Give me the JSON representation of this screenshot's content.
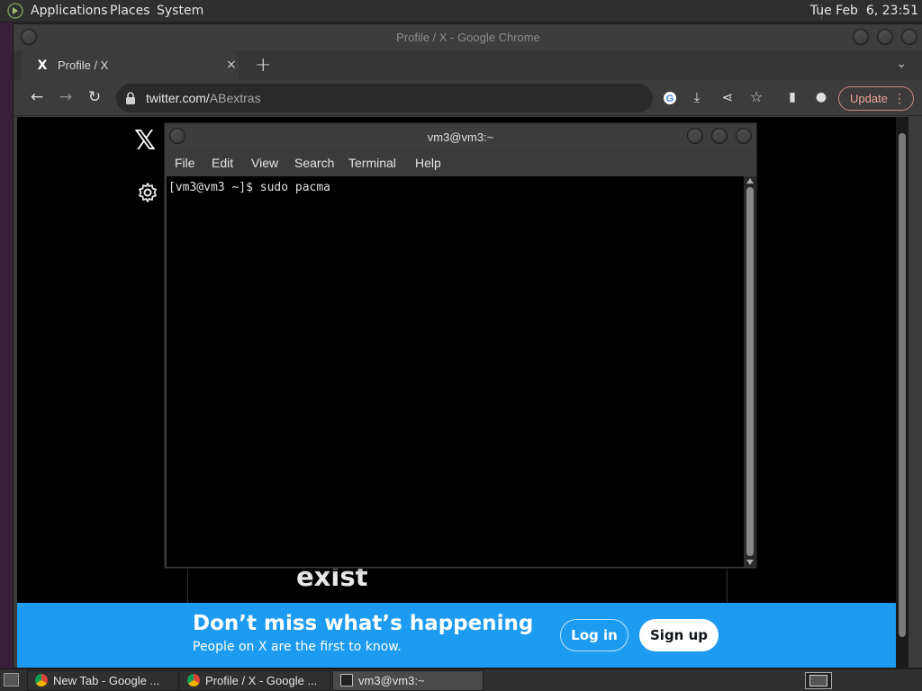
{
  "top_panel": {
    "menus": [
      "Applications",
      "Places",
      "System"
    ],
    "clock": "Tue Feb  6, 23:51"
  },
  "chrome": {
    "window_title": "Profile / X - Google Chrome",
    "tab": {
      "title": "Profile / X",
      "close": "×"
    },
    "new_tab": "+",
    "tab_search": "⌄",
    "url_host": "twitter.com/",
    "url_path": "ABextras",
    "update_label": "Update",
    "update_menu": "⋮",
    "nav": {
      "back": "←",
      "forward": "→",
      "reload": "↻"
    },
    "toolbar_icons": {
      "install": "⤓",
      "share": "⋖",
      "bookmark": "☆",
      "sidebar": "▮",
      "profile": "●"
    }
  },
  "page": {
    "x_logo": "𝕏",
    "exist_text": "exist",
    "banner": {
      "title": "Don’t miss what’s happening",
      "subtitle": "People on X are the first to know.",
      "login": "Log in",
      "signup": "Sign up"
    }
  },
  "terminal": {
    "title": "vm3@vm3:~",
    "menus": [
      "File",
      "Edit",
      "View",
      "Search",
      "Terminal",
      "Help"
    ],
    "content": "[vm3@vm3 ~]$ sudo pacma"
  },
  "taskbar": {
    "items": [
      {
        "label": "New Tab - Google ...",
        "icon": "chrome-icon"
      },
      {
        "label": "Profile / X - Google ...",
        "icon": "chrome-icon"
      },
      {
        "label": "vm3@vm3:~",
        "icon": "terminal-icon"
      }
    ]
  },
  "colors": {
    "banner_blue": "#1d9bf0",
    "update_accent": "#f0a596"
  }
}
